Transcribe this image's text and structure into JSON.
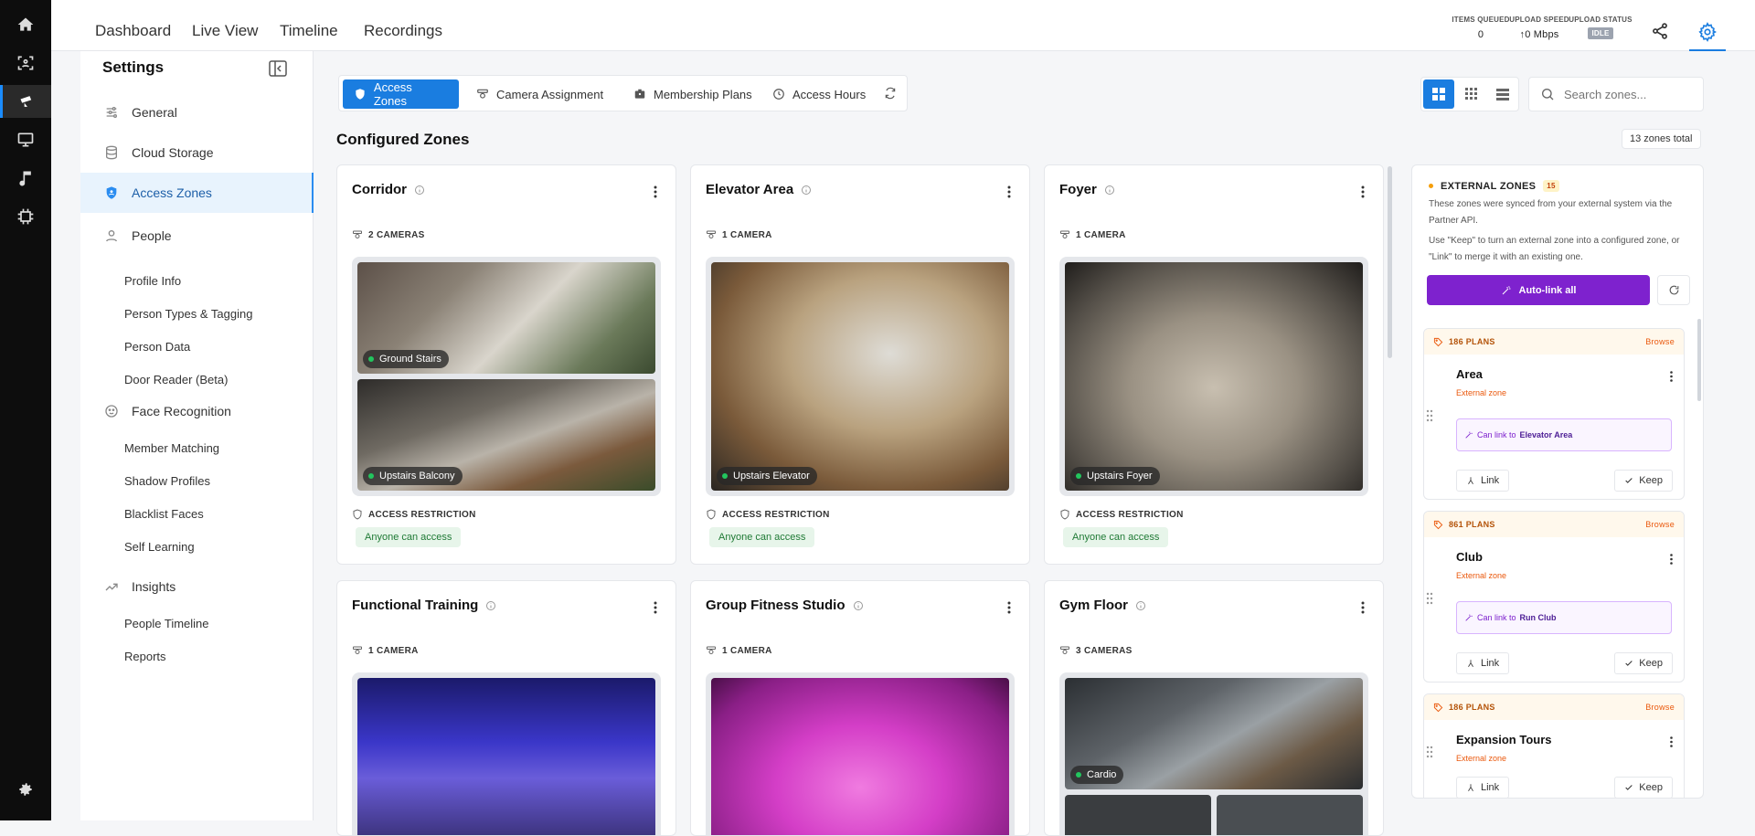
{
  "nav": [
    "Dashboard",
    "Live View",
    "Timeline",
    "Recordings"
  ],
  "stats": {
    "items_queued_label": "ITEMS QUEUED",
    "items_queued": "0",
    "upload_speed_label": "UPLOAD SPEED",
    "upload_speed": "↑0 Mbps",
    "upload_status_label": "UPLOAD STATUS",
    "upload_status": "IDLE"
  },
  "sidebar": {
    "title": "Settings",
    "items": [
      "General",
      "Cloud Storage",
      "Access Zones",
      "People",
      "Face Recognition",
      "Insights"
    ],
    "people_sub": [
      "Profile Info",
      "Person Types & Tagging",
      "Person Data",
      "Door Reader (Beta)"
    ],
    "face_sub": [
      "Member Matching",
      "Shadow Profiles",
      "Blacklist Faces",
      "Self Learning"
    ],
    "insights_sub": [
      "People Timeline",
      "Reports"
    ]
  },
  "tabs": [
    "Access Zones",
    "Camera Assignment",
    "Membership Plans",
    "Access Hours"
  ],
  "search": {
    "placeholder": "Search zones..."
  },
  "section": {
    "title": "Configured Zones",
    "total": "13 zones total"
  },
  "zones": [
    {
      "name": "Corridor",
      "cameras": "2 CAMERAS",
      "labels": [
        "Ground Stairs",
        "Upstairs Balcony"
      ],
      "restriction": "ACCESS RESTRICTION",
      "access": "Anyone can access"
    },
    {
      "name": "Elevator Area",
      "cameras": "1 CAMERA",
      "labels": [
        "Upstairs Elevator"
      ],
      "restriction": "ACCESS RESTRICTION",
      "access": "Anyone can access"
    },
    {
      "name": "Foyer",
      "cameras": "1 CAMERA",
      "labels": [
        "Upstairs Foyer"
      ],
      "restriction": "ACCESS RESTRICTION",
      "access": "Anyone can access"
    },
    {
      "name": "Functional Training",
      "cameras": "1 CAMERA",
      "labels": []
    },
    {
      "name": "Group Fitness Studio",
      "cameras": "1 CAMERA",
      "labels": []
    },
    {
      "name": "Gym Floor",
      "cameras": "3 CAMERAS",
      "labels": [
        "Cardio"
      ]
    }
  ],
  "external": {
    "title": "EXTERNAL ZONES",
    "count": "15",
    "desc1": "These zones were synced from your external system via the Partner API.",
    "desc2": "Use \"Keep\" to turn an external zone into a configured zone, or \"Link\" to merge it with an existing one.",
    "autolink": "Auto-link all",
    "cards": [
      {
        "plans": "186 PLANS",
        "browse": "Browse",
        "name": "Area",
        "sub": "External zone",
        "hint": "Can link to",
        "target": "Elevator Area",
        "link": "Link",
        "keep": "Keep"
      },
      {
        "plans": "861 PLANS",
        "browse": "Browse",
        "name": "Club",
        "sub": "External zone",
        "hint": "Can link to",
        "target": "Run Club",
        "link": "Link",
        "keep": "Keep"
      },
      {
        "plans": "186 PLANS",
        "browse": "Browse",
        "name": "Expansion Tours",
        "sub": "External zone",
        "hint": "",
        "target": "",
        "link": "Link",
        "keep": "Keep"
      }
    ]
  },
  "colors": {
    "accent": "#1a7de0",
    "purple": "#7e22ce",
    "access_green": "#1f7a35"
  }
}
